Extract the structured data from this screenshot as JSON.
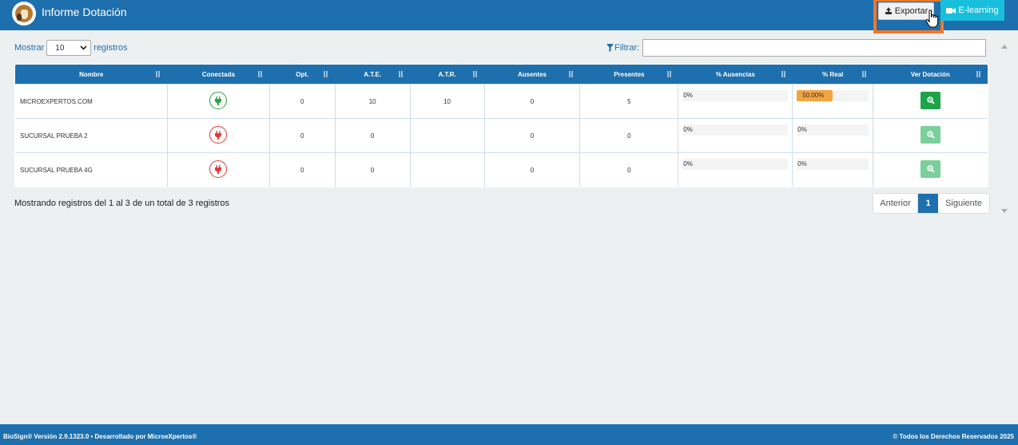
{
  "header": {
    "title": "Informe Dotación",
    "export_label": "Exportar",
    "elearning_label": "E-learning",
    "colors": {
      "primary": "#1e6fad",
      "elearning": "#18bfdc",
      "highlight": "#f0782a"
    }
  },
  "controls": {
    "show_label": "Mostrar",
    "show_value": "10",
    "records_label": "registros",
    "filter_label": "Filtrar:",
    "filter_value": ""
  },
  "table": {
    "columns": [
      "Nombre",
      "Conectada",
      "Opt.",
      "A.T.E.",
      "A.T.R.",
      "Ausentes",
      "Presentes",
      "% Ausencias",
      "% Real",
      "Ver Dotación"
    ],
    "rows": [
      {
        "nombre": "MICROEXPERTOS.COM",
        "conectada": true,
        "opt": "0",
        "ate": "10",
        "atr": "10",
        "ausentes": "0",
        "presentes": "5",
        "pct_ausencias": "0%",
        "pct_ausencias_value": 0,
        "pct_real": "50.00%",
        "pct_real_value": 50,
        "ver_enabled": true
      },
      {
        "nombre": "SUCURSAL PRUEBA 2",
        "conectada": false,
        "opt": "0",
        "ate": "0",
        "atr": "",
        "ausentes": "0",
        "presentes": "0",
        "pct_ausencias": "0%",
        "pct_ausencias_value": 0,
        "pct_real": "0%",
        "pct_real_value": 0,
        "ver_enabled": false
      },
      {
        "nombre": "SUCURSAL PRUEBA 4G",
        "conectada": false,
        "opt": "0",
        "ate": "0",
        "atr": "",
        "ausentes": "0",
        "presentes": "0",
        "pct_ausencias": "0%",
        "pct_ausencias_value": 0,
        "pct_real": "0%",
        "pct_real_value": 0,
        "ver_enabled": false
      }
    ]
  },
  "info": "Mostrando registros del 1 al 3 de un total de 3 registros",
  "pagination": {
    "prev": "Anterior",
    "current": "1",
    "next": "Siguiente"
  },
  "footer": {
    "left": "BioSign® Versión 2.9.1323.0 • Desarrollado por MicroeXpertos®",
    "right": "© Todos los Derechos Reservados 2025"
  }
}
